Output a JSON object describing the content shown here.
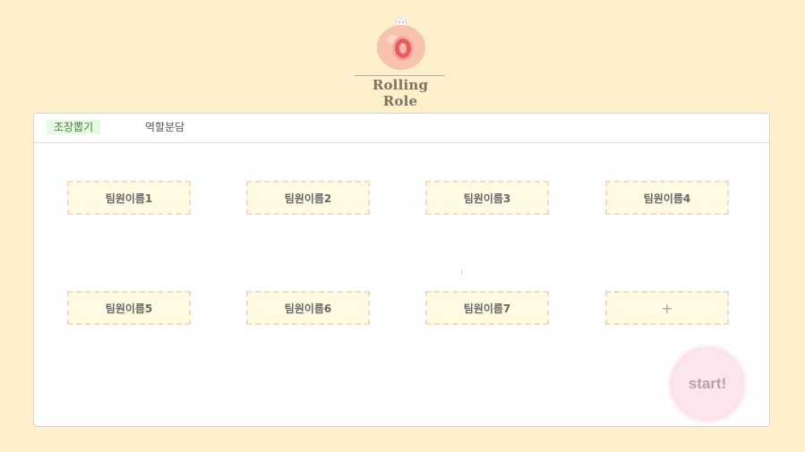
{
  "header": {
    "brand_name": "Rolling Role",
    "logo_icon": "strawberry-mascot-icon"
  },
  "tabs": [
    {
      "label": "조장뽑기",
      "active": true
    },
    {
      "label": "역할분담",
      "active": false
    }
  ],
  "members": [
    {
      "label": "팀원이름1"
    },
    {
      "label": "팀원이름2"
    },
    {
      "label": "팀원이름3"
    },
    {
      "label": "팀원이름4"
    },
    {
      "label": "팀원이름5"
    },
    {
      "label": "팀원이름6"
    },
    {
      "label": "팀원이름7"
    }
  ],
  "add_member": {
    "label": "+"
  },
  "start_button": {
    "label": "start!"
  },
  "colors": {
    "background": "#fff0cc",
    "panel": "#ffffff",
    "member_fill": "#fffbe3",
    "member_border": "#f7d8c8",
    "active_tab_bg": "#e7fbe2",
    "start_bg": "#fde6eb"
  }
}
